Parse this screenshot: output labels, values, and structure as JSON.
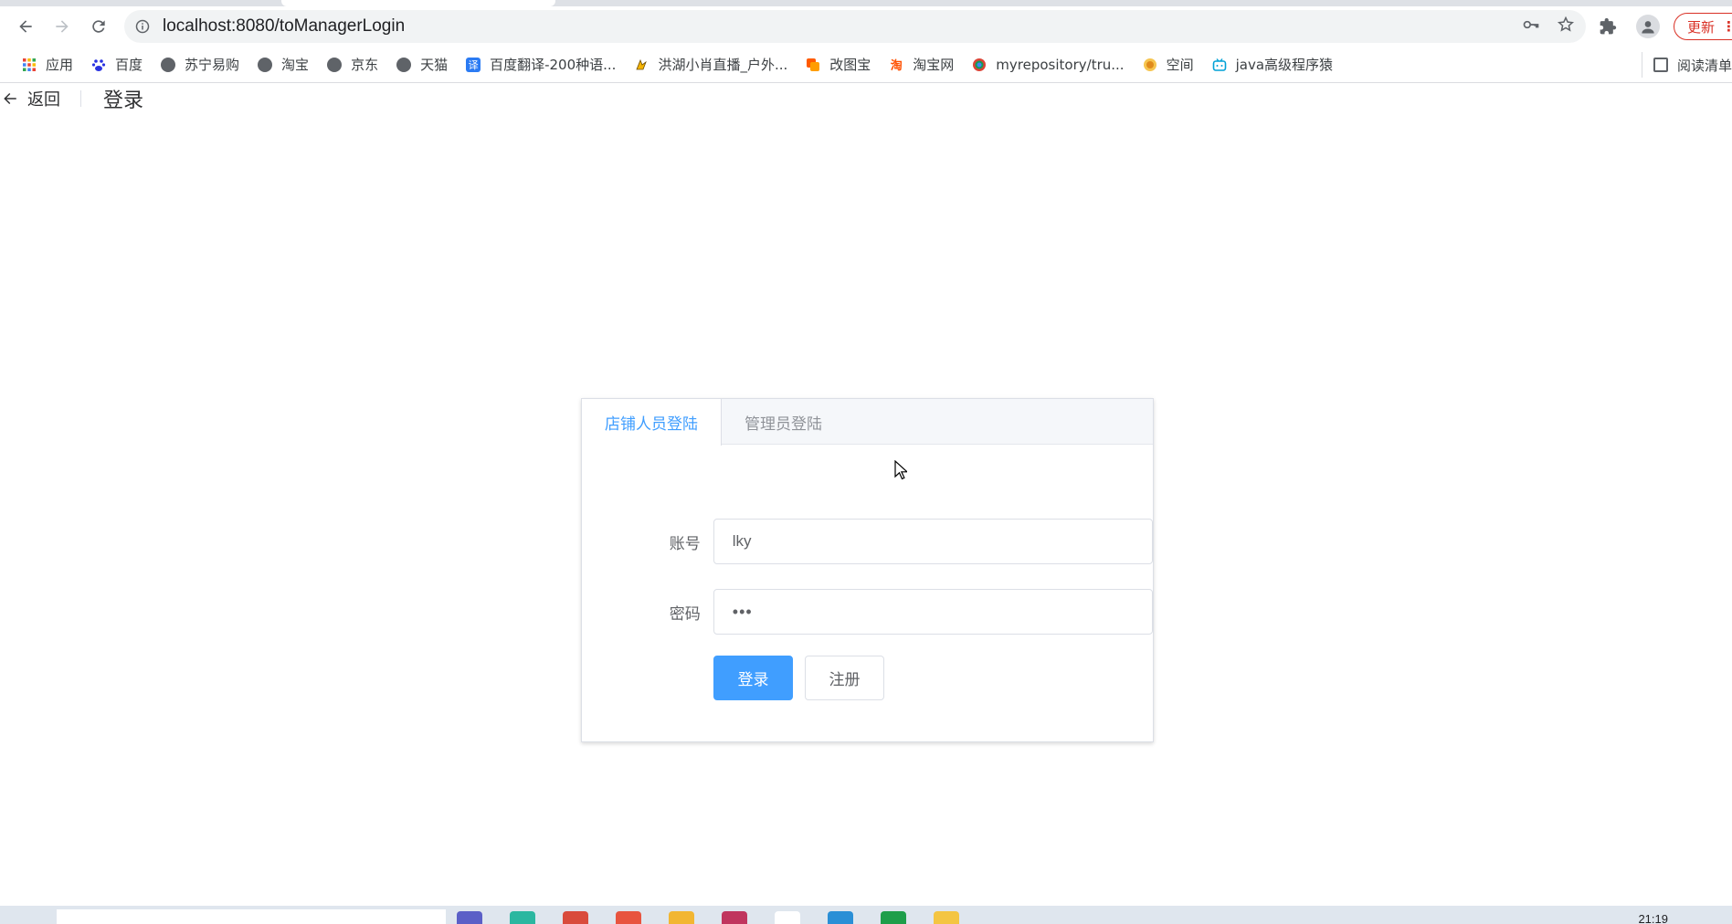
{
  "browser": {
    "url": "localhost:8080/toManagerLogin",
    "update_label": "更新",
    "bookmarks": [
      {
        "label": "应用",
        "icon": "apps-grid-icon"
      },
      {
        "label": "百度",
        "icon": "baidu-icon"
      },
      {
        "label": "苏宁易购",
        "icon": "globe-icon"
      },
      {
        "label": "淘宝",
        "icon": "globe-icon"
      },
      {
        "label": "京东",
        "icon": "globe-icon"
      },
      {
        "label": "天猫",
        "icon": "globe-icon"
      },
      {
        "label": "百度翻译-200种语...",
        "icon": "translate-icon"
      },
      {
        "label": "洪湖小肖直播_户外...",
        "icon": "live-icon"
      },
      {
        "label": "改图宝",
        "icon": "image-tool-icon"
      },
      {
        "label": "淘宝网",
        "icon": "taobao-icon"
      },
      {
        "label": "myrepository/tru...",
        "icon": "repo-icon"
      },
      {
        "label": "空间",
        "icon": "qzone-icon"
      },
      {
        "label": "java高级程序猿",
        "icon": "bilibili-icon"
      }
    ],
    "reading_list_label": "阅读清单"
  },
  "header": {
    "back_label": "返回",
    "title": "登录"
  },
  "login": {
    "tabs": [
      {
        "label": "店铺人员登陆",
        "active": true
      },
      {
        "label": "管理员登陆",
        "active": false
      }
    ],
    "account_label": "账号",
    "account_value": "lky",
    "password_label": "密码",
    "password_value": "•••",
    "login_button": "登录",
    "register_button": "注册"
  },
  "taskbar": {
    "time": "21:19"
  },
  "colors": {
    "primary": "#409eff",
    "update": "#d93025"
  }
}
